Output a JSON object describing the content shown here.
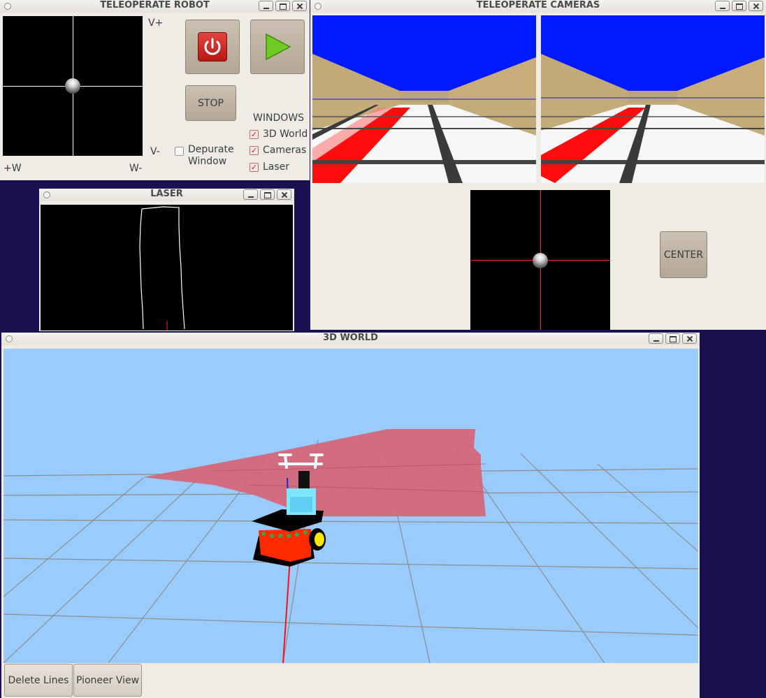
{
  "teleop_robot": {
    "title": "TELEOPERATE ROBOT",
    "labels": {
      "v_plus": "V+",
      "v_minus": "V-",
      "w_plus": "+W",
      "w_minus": "W-"
    },
    "stop_label": "STOP",
    "depurate_label": "Depurate\nWindow",
    "depurate_checked": false,
    "windows_heading": "WINDOWS",
    "windows": [
      {
        "label": "3D World",
        "checked": true
      },
      {
        "label": "Cameras",
        "checked": true
      },
      {
        "label": "Laser",
        "checked": true
      }
    ],
    "power_color": "#d42a24",
    "play_color": "#66c21e"
  },
  "teleop_cameras": {
    "title": "TELEOPERATE CAMERAS",
    "center_label": "CENTER"
  },
  "laser": {
    "title": "LASER"
  },
  "world3d": {
    "title": "3D WORLD",
    "delete_lines_label": "Delete Lines",
    "pioneer_view_label": "Pioneer View",
    "sky_color": "#99ccfc",
    "laser_color": "#d4667a"
  }
}
